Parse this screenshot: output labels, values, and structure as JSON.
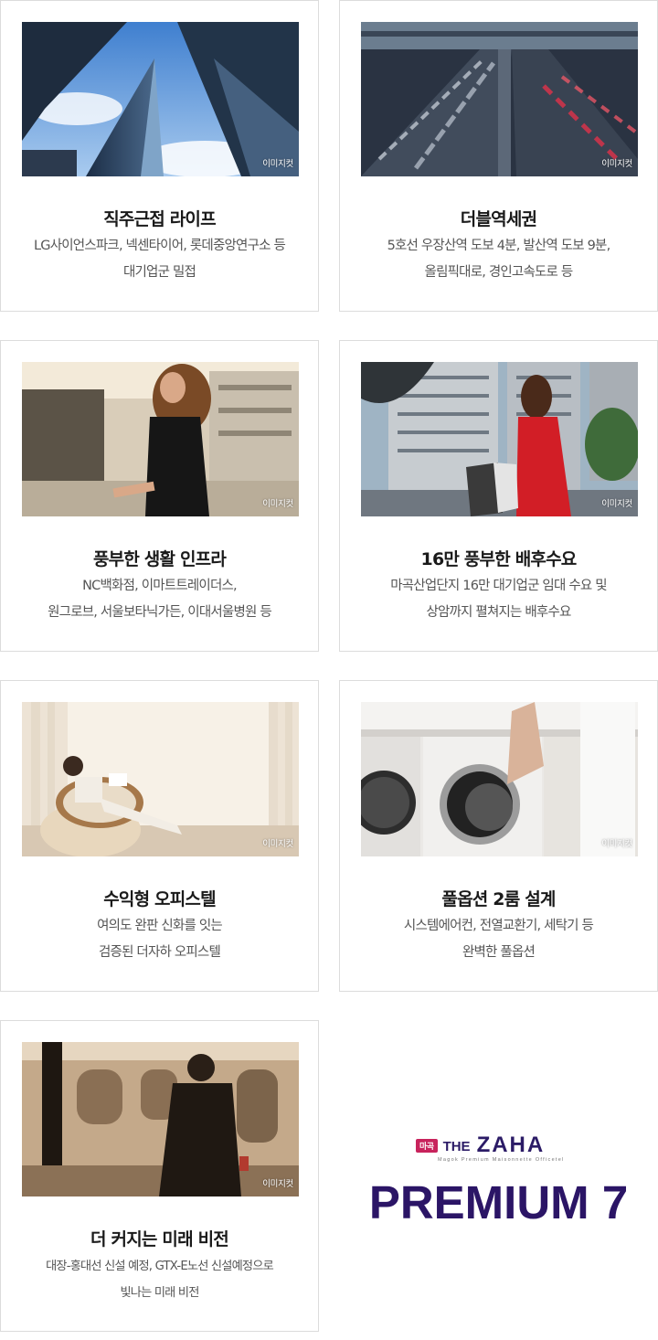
{
  "image_tag": "이미지컷",
  "cards": [
    {
      "title": "직주근접 라이프",
      "lines": [
        "LG사이언스파크, 넥센타이어, 롯데중앙연구소 등",
        "대기업군 밀접"
      ],
      "image": "office-skyscrapers-photo"
    },
    {
      "title": "더블역세권",
      "lines": [
        "5호선 우장산역 도보 4분, 발산역 도보 9분,",
        "올림픽대로, 경인고속도로 등"
      ],
      "image": "highway-traffic-photo"
    },
    {
      "title": "풍부한 생활 인프라",
      "lines": [
        "NC백화점, 이마트트레이더스,",
        "원그로브, 서울보타닉가든, 이대서울병원 등"
      ],
      "image": "woman-walking-city-photo"
    },
    {
      "title": "16만 풍부한 배후수요",
      "lines": [
        "마곡산업단지 16만 대기업군 임대 수요 및",
        "상암까지 펼쳐지는 배후수요"
      ],
      "image": "woman-shopping-bags-photo"
    },
    {
      "title": "수익형 오피스텔",
      "lines": [
        "여의도 완판 신화를 잇는",
        "검증된 더자하 오피스텔"
      ],
      "image": "woman-reading-chair-photo"
    },
    {
      "title": "풀옵션 2룸 설계",
      "lines": [
        "시스템에어컨, 전열교환기, 세탁기 등",
        "완벽한 풀옵션"
      ],
      "image": "washing-machine-photo"
    },
    {
      "title": "더 커지는 미래 비전",
      "lines": [
        "대장-홍대선 신설 예정, GTX-E노선 신설예정으로",
        "빛나는 미래 비전"
      ],
      "image": "man-subway-platform-photo"
    }
  ],
  "brand": {
    "badge": "마곡",
    "the": "THE",
    "name": "ZAHA",
    "tagline": "Magok Premium Maisonnette Officetel",
    "headline": "PREMIUM 7",
    "color": "#2b1566",
    "badge_color": "#c8235c"
  }
}
